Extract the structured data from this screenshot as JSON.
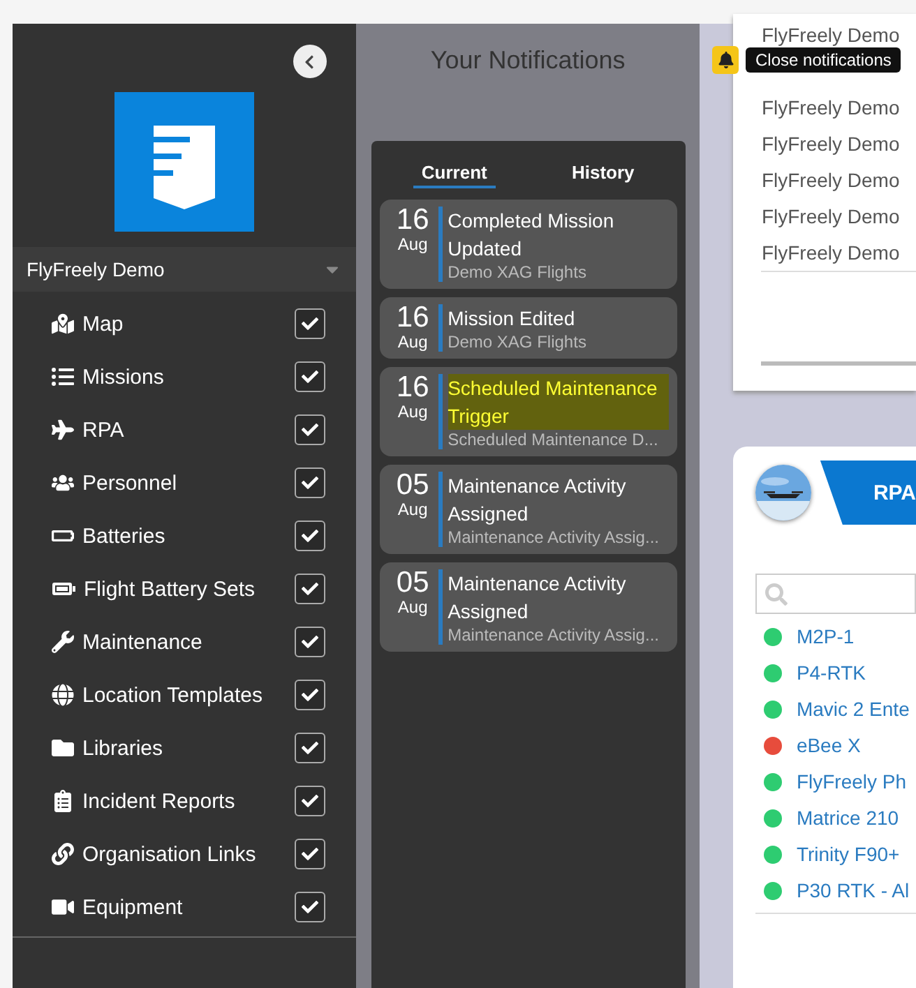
{
  "sidebar": {
    "organisation": "FlyFreely Demo",
    "items": [
      {
        "label": "Map",
        "checked": true
      },
      {
        "label": "Missions",
        "checked": true
      },
      {
        "label": "RPA",
        "checked": true
      },
      {
        "label": "Personnel",
        "checked": true
      },
      {
        "label": "Batteries",
        "checked": true
      },
      {
        "label": "Flight Battery Sets",
        "checked": true
      },
      {
        "label": "Maintenance",
        "checked": true
      },
      {
        "label": "Location Templates",
        "checked": true
      },
      {
        "label": "Libraries",
        "checked": true
      },
      {
        "label": "Incident Reports",
        "checked": true
      },
      {
        "label": "Organisation Links",
        "checked": true
      },
      {
        "label": "Equipment",
        "checked": true
      }
    ]
  },
  "notifications": {
    "title": "Your Notifications",
    "tooltip": "Close notifications",
    "tabs": [
      {
        "label": "Current",
        "selected": true
      },
      {
        "label": "History",
        "selected": false
      }
    ],
    "items": [
      {
        "day": "16",
        "month": "Aug",
        "title": "Completed Mission Updated",
        "subtitle": "Demo XAG Flights",
        "highlighted": false
      },
      {
        "day": "16",
        "month": "Aug",
        "title": "Mission Edited",
        "subtitle": "Demo XAG Flights",
        "highlighted": false
      },
      {
        "day": "16",
        "month": "Aug",
        "title": "Scheduled Maintenance Trigger",
        "subtitle": "Scheduled Maintenance D...",
        "highlighted": true
      },
      {
        "day": "05",
        "month": "Aug",
        "title": "Maintenance Activity Assigned",
        "subtitle": "Maintenance Activity Assig...",
        "highlighted": false
      },
      {
        "day": "05",
        "month": "Aug",
        "title": "Maintenance Activity Assigned",
        "subtitle": "Maintenance Activity Assig...",
        "highlighted": false
      }
    ]
  },
  "organisations_card": {
    "rows": [
      "FlyFreely Demo",
      "FlyFreely Demo",
      "FlyFreely Demo",
      "FlyFreely Demo",
      "FlyFreely Demo",
      "FlyFreely Demo"
    ]
  },
  "rpa_card": {
    "tab": "RPA",
    "items": [
      {
        "name": "M2P-1",
        "color": "#2ecc71"
      },
      {
        "name": "P4-RTK",
        "color": "#2ecc71"
      },
      {
        "name": "Mavic 2 Ente",
        "color": "#2ecc71"
      },
      {
        "name": "eBee X",
        "color": "#e74c3c"
      },
      {
        "name": "FlyFreely Ph",
        "color": "#2ecc71"
      },
      {
        "name": "Matrice 210",
        "color": "#2ecc71"
      },
      {
        "name": "Trinity F90+",
        "color": "#2ecc71"
      },
      {
        "name": "P30 RTK - Al",
        "color": "#2ecc71"
      }
    ]
  }
}
